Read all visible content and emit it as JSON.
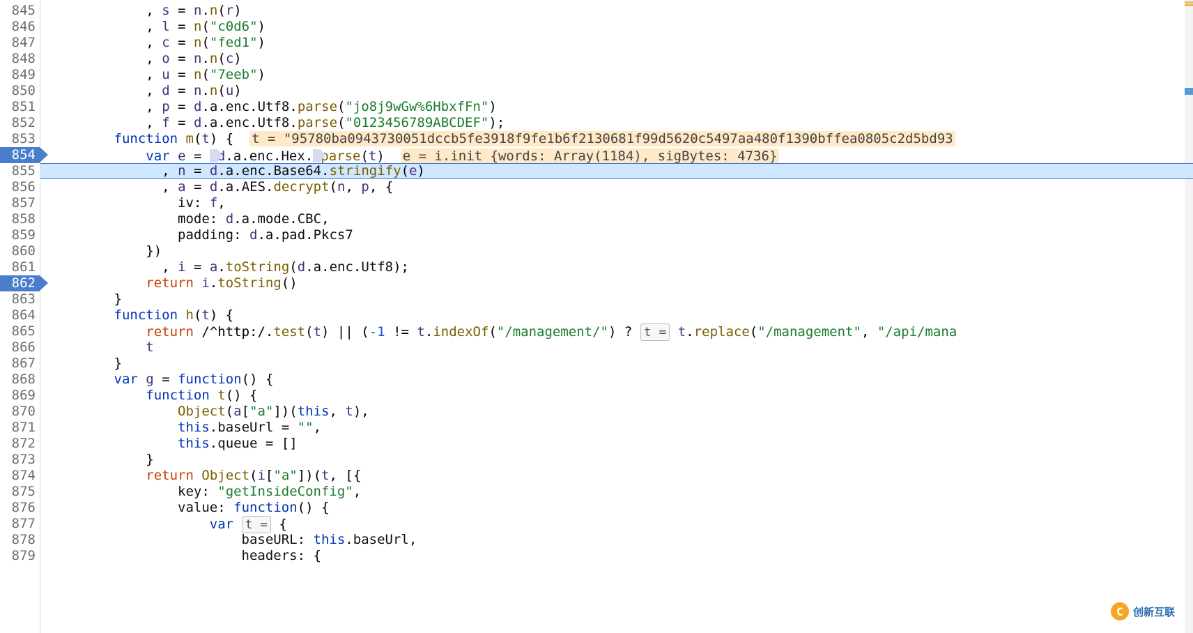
{
  "first_line_number": 845,
  "breakpoint_rows": [
    854,
    862
  ],
  "current_row": 855,
  "watermark_text": "创新互联",
  "lines": [
    {
      "n": 845,
      "html": "            <span class='punc'>,</span> <span class='ident'>s</span> <span class='op'>=</span> <span class='ident'>n</span><span class='punc'>.</span><span class='fn'>n</span><span class='punc'>(</span><span class='ident'>r</span><span class='punc'>)</span>"
    },
    {
      "n": 846,
      "html": "            <span class='punc'>,</span> <span class='ident'>l</span> <span class='op'>=</span> <span class='fn'>n</span><span class='punc'>(</span><span class='str'>\"c0d6\"</span><span class='punc'>)</span>"
    },
    {
      "n": 847,
      "html": "            <span class='punc'>,</span> <span class='ident'>c</span> <span class='op'>=</span> <span class='fn'>n</span><span class='punc'>(</span><span class='str'>\"fed1\"</span><span class='punc'>)</span>"
    },
    {
      "n": 848,
      "html": "            <span class='punc'>,</span> <span class='ident'>o</span> <span class='op'>=</span> <span class='ident'>n</span><span class='punc'>.</span><span class='fn'>n</span><span class='punc'>(</span><span class='ident'>c</span><span class='punc'>)</span>"
    },
    {
      "n": 849,
      "html": "            <span class='punc'>,</span> <span class='ident'>u</span> <span class='op'>=</span> <span class='fn'>n</span><span class='punc'>(</span><span class='str'>\"7eeb\"</span><span class='punc'>)</span>"
    },
    {
      "n": 850,
      "html": "            <span class='punc'>,</span> <span class='ident'>d</span> <span class='op'>=</span> <span class='ident'>n</span><span class='punc'>.</span><span class='fn'>n</span><span class='punc'>(</span><span class='ident'>u</span><span class='punc'>)</span>"
    },
    {
      "n": 851,
      "html": "            <span class='punc'>,</span> <span class='ident'>p</span> <span class='op'>=</span> <span class='ident'>d</span><span class='punc'>.</span><span class='prop'>a</span><span class='punc'>.</span><span class='prop'>enc</span><span class='punc'>.</span><span class='prop'>Utf8</span><span class='punc'>.</span><span class='fn'>parse</span><span class='punc'>(</span><span class='str'>\"jo8j9wGw%6HbxfFn\"</span><span class='punc'>)</span>"
    },
    {
      "n": 852,
      "html": "            <span class='punc'>,</span> <span class='ident'>f</span> <span class='op'>=</span> <span class='ident'>d</span><span class='punc'>.</span><span class='prop'>a</span><span class='punc'>.</span><span class='prop'>enc</span><span class='punc'>.</span><span class='prop'>Utf8</span><span class='punc'>.</span><span class='fn'>parse</span><span class='punc'>(</span><span class='str'>\"0123456789ABCDEF\"</span><span class='punc'>);</span>"
    },
    {
      "n": 853,
      "html": "        <span class='kw'>function</span> <span class='fn'>m</span><span class='punc'>(</span><span class='ident'>t</span><span class='punc'>) {</span>  <span class='hint'>t = \"95780ba0943730051dccb5fe3918f9fe1b6f2130681f99d5620c5497aa480f1390bffea0805c2d5bd93</span>"
    },
    {
      "n": 854,
      "html": "            <span class='kw'>var</span> <span class='ident'>e</span> <span class='op'>=</span> <span class='pale-arrow'></span><span class='ident'>d</span><span class='punc'>.</span><span class='prop'>a</span><span class='punc'>.</span><span class='prop'>enc</span><span class='punc'>.</span><span class='prop'>Hex</span><span class='punc'>.</span><span class='pale-arrow'></span><span class='fn'>parse</span><span class='punc'>(</span><span class='ident'>t</span><span class='punc'>)</span>  <span class='hint'>e = i.init {words: Array(1184), sigBytes: 4736}</span>"
    },
    {
      "n": 855,
      "html": "              <span class='punc'>,</span> <span class='ident'>n</span> <span class='op'>=</span> <span class='ident'>d</span><span class='punc'>.</span><span class='prop'>a</span><span class='punc'>.</span><span class='prop'>enc</span><span class='punc'>.</span><span class='prop'>Base64</span><span class='punc'>.</span><span class='fn'>stringify</span><span class='punc'>(</span><span class='ident'>e</span><span class='punc'>)</span>"
    },
    {
      "n": 856,
      "html": "              <span class='punc'>,</span> <span class='ident'>a</span> <span class='op'>=</span> <span class='ident'>d</span><span class='punc'>.</span><span class='prop'>a</span><span class='punc'>.</span><span class='prop'>AES</span><span class='punc'>.</span><span class='fn'>decrypt</span><span class='punc'>(</span><span class='ident'>n</span><span class='punc'>,</span> <span class='ident'>p</span><span class='punc'>, {</span>"
    },
    {
      "n": 857,
      "html": "                <span class='prop'>iv</span><span class='punc'>:</span> <span class='ident'>f</span><span class='punc'>,</span>"
    },
    {
      "n": 858,
      "html": "                <span class='prop'>mode</span><span class='punc'>:</span> <span class='ident'>d</span><span class='punc'>.</span><span class='prop'>a</span><span class='punc'>.</span><span class='prop'>mode</span><span class='punc'>.</span><span class='prop'>CBC</span><span class='punc'>,</span>"
    },
    {
      "n": 859,
      "html": "                <span class='prop'>padding</span><span class='punc'>:</span> <span class='ident'>d</span><span class='punc'>.</span><span class='prop'>a</span><span class='punc'>.</span><span class='prop'>pad</span><span class='punc'>.</span><span class='prop'>Pkcs7</span>"
    },
    {
      "n": 860,
      "html": "            <span class='punc'>})</span>"
    },
    {
      "n": 861,
      "html": "              <span class='punc'>,</span> <span class='ident'>i</span> <span class='op'>=</span> <span class='ident'>a</span><span class='punc'>.</span><span class='fn'>toString</span><span class='punc'>(</span><span class='ident'>d</span><span class='punc'>.</span><span class='prop'>a</span><span class='punc'>.</span><span class='prop'>enc</span><span class='punc'>.</span><span class='prop'>Utf8</span><span class='punc'>);</span>"
    },
    {
      "n": 862,
      "html": "            <span class='kw2'>return</span> <span class='ident'>i</span><span class='punc'>.</span><span class='fn'>toString</span><span class='punc'>()</span>"
    },
    {
      "n": 863,
      "html": "        <span class='punc'>}</span>"
    },
    {
      "n": 864,
      "html": "        <span class='kw'>function</span> <span class='fn'>h</span><span class='punc'>(</span><span class='ident'>t</span><span class='punc'>) {</span>"
    },
    {
      "n": 865,
      "html": "            <span class='kw2'>return</span> <span class='op'>/^http:/</span><span class='punc'>.</span><span class='fn'>test</span><span class='punc'>(</span><span class='ident'>t</span><span class='punc'>)</span> <span class='op'>||</span> <span class='punc'>(</span><span class='num'>-1</span> <span class='op'>!=</span> <span class='ident'>t</span><span class='punc'>.</span><span class='fn'>indexOf</span><span class='punc'>(</span><span class='str'>\"/management/\"</span><span class='punc'>)</span> <span class='op'>?</span> <span class='hintbox'>t =</span> <span class='ident'>t</span><span class='punc'>.</span><span class='fn'>replace</span><span class='punc'>(</span><span class='str'>\"/management\"</span><span class='punc'>,</span> <span class='str'>\"/api/mana</span>"
    },
    {
      "n": 866,
      "html": "            <span class='ident'>t</span>"
    },
    {
      "n": 867,
      "html": "        <span class='punc'>}</span>"
    },
    {
      "n": 868,
      "html": "        <span class='kw'>var</span> <span class='ident'>g</span> <span class='op'>=</span> <span class='kw'>function</span><span class='punc'>() {</span>"
    },
    {
      "n": 869,
      "html": "            <span class='kw'>function</span> <span class='fn'>t</span><span class='punc'>() {</span>"
    },
    {
      "n": 870,
      "html": "                <span class='fn'>Object</span><span class='punc'>(</span><span class='ident'>a</span><span class='punc'>[</span><span class='str'>\"a\"</span><span class='punc'>])(</span><span class='kw'>this</span><span class='punc'>,</span> <span class='ident'>t</span><span class='punc'>),</span>"
    },
    {
      "n": 871,
      "html": "                <span class='kw'>this</span><span class='punc'>.</span><span class='prop'>baseUrl</span> <span class='op'>=</span> <span class='str'>\"\"</span><span class='punc'>,</span>"
    },
    {
      "n": 872,
      "html": "                <span class='kw'>this</span><span class='punc'>.</span><span class='prop'>queue</span> <span class='op'>=</span> <span class='punc'>[]</span>"
    },
    {
      "n": 873,
      "html": "            <span class='punc'>}</span>"
    },
    {
      "n": 874,
      "html": "            <span class='kw2'>return</span> <span class='fn'>Object</span><span class='punc'>(</span><span class='ident'>i</span><span class='punc'>[</span><span class='str'>\"a\"</span><span class='punc'>])(</span><span class='ident'>t</span><span class='punc'>,</span> <span class='punc'>[{</span>"
    },
    {
      "n": 875,
      "html": "                <span class='prop'>key</span><span class='punc'>:</span> <span class='str'>\"getInsideConfig\"</span><span class='punc'>,</span>"
    },
    {
      "n": 876,
      "html": "                <span class='prop'>value</span><span class='punc'>:</span> <span class='kw'>function</span><span class='punc'>() {</span>"
    },
    {
      "n": 877,
      "html": "                    <span class='kw'>var</span> <span class='hintbox'>t =</span> <span class='punc'>{</span>"
    },
    {
      "n": 878,
      "html": "                        <span class='prop'>baseURL</span><span class='punc'>:</span> <span class='kw'>this</span><span class='punc'>.</span><span class='prop'>baseUrl</span><span class='punc'>,</span>"
    },
    {
      "n": 879,
      "html": "                        <span class='prop'>headers</span><span class='punc'>:</span> <span class='punc'>{</span>"
    }
  ]
}
